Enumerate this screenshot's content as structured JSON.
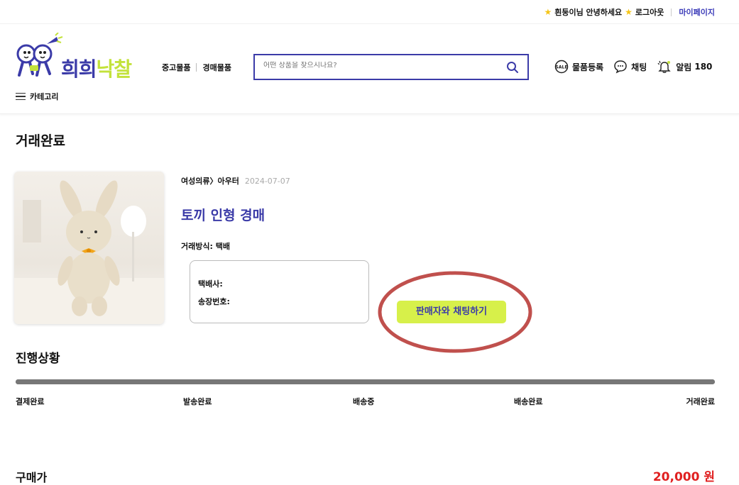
{
  "topbar": {
    "greeting": "흰둥이님 안녕하세요",
    "logout": "로그아웃",
    "mypage": "마이페이지"
  },
  "header": {
    "logo_text_part1": "희희",
    "logo_text_part2": "낙찰",
    "nav_used": "중고물품",
    "nav_auction": "경매물품",
    "search_placeholder": "어떤 상품을 찾으시나요?",
    "register_label": "물품등록",
    "chat_label": "채팅",
    "alarm_label": "알림",
    "alarm_count": "180",
    "category_label": "카테고리",
    "sale_badge": "SALE"
  },
  "main": {
    "page_title": "거래완료",
    "breadcrumb": "여성의류〉아우터",
    "date": "2024-07-07",
    "product_title": "토끼 인형 경매",
    "trade_method": "거래방식: 택배",
    "courier_label": "택배사:",
    "tracking_label": "송장번호:",
    "chat_button": "판매자와 채팅하기"
  },
  "progress": {
    "title": "진행상황",
    "fill_fraction": 1.0,
    "steps": [
      "결제완료",
      "발송완료",
      "배송중",
      "배송완료",
      "거래완료"
    ]
  },
  "price": {
    "label": "구매가",
    "value": "20,000 원"
  },
  "colors": {
    "brand": "#3b3ba8",
    "accent": "#d7f04a",
    "price": "#e02020",
    "highlight": "#c0504d"
  }
}
